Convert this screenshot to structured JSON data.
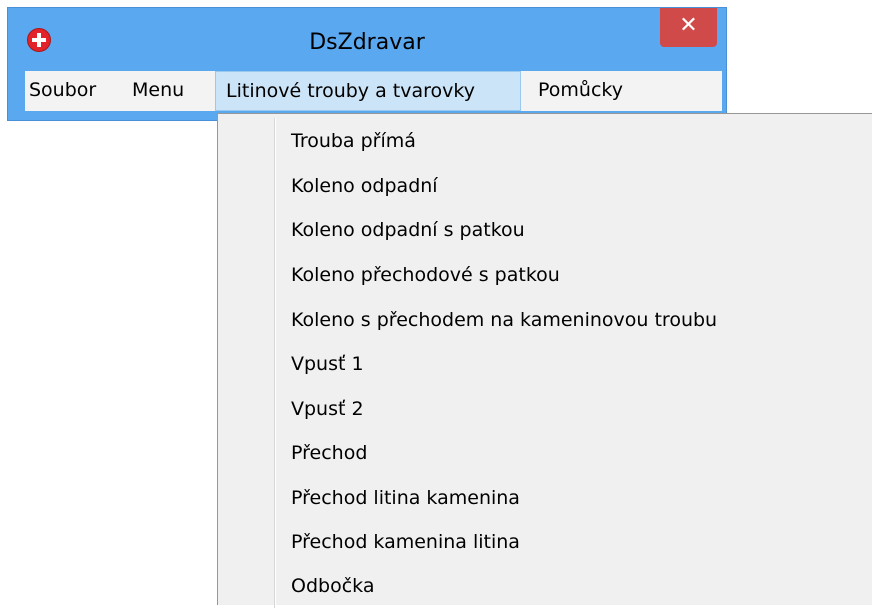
{
  "window": {
    "title": "DsZdravar",
    "close_label": "✕"
  },
  "menubar": {
    "items": [
      {
        "label": "Soubor"
      },
      {
        "label": "Menu"
      },
      {
        "label": "Litinové trouby a tvarovky",
        "active": true
      },
      {
        "label": "Pomůcky"
      }
    ]
  },
  "dropdown": {
    "items": [
      {
        "label": "Trouba přímá"
      },
      {
        "label": "Koleno odpadní"
      },
      {
        "label": "Koleno odpadní s patkou"
      },
      {
        "label": "Koleno přechodové s patkou"
      },
      {
        "label": "Koleno s přechodem na kameninovou troubu"
      },
      {
        "label": "Vpusť 1"
      },
      {
        "label": "Vpusť 2"
      },
      {
        "label": "Přechod"
      },
      {
        "label": "Přechod litina kamenina"
      },
      {
        "label": "Přechod kamenina litina"
      },
      {
        "label": "Odbočka"
      }
    ]
  },
  "colors": {
    "titlebar": "#5aa8f0",
    "close_button": "#d04a4a",
    "menu_active": "#cce4f7",
    "dropdown_bg": "#f0f0f0"
  },
  "icons": {
    "app": "red-cross-icon",
    "close": "close-icon"
  }
}
